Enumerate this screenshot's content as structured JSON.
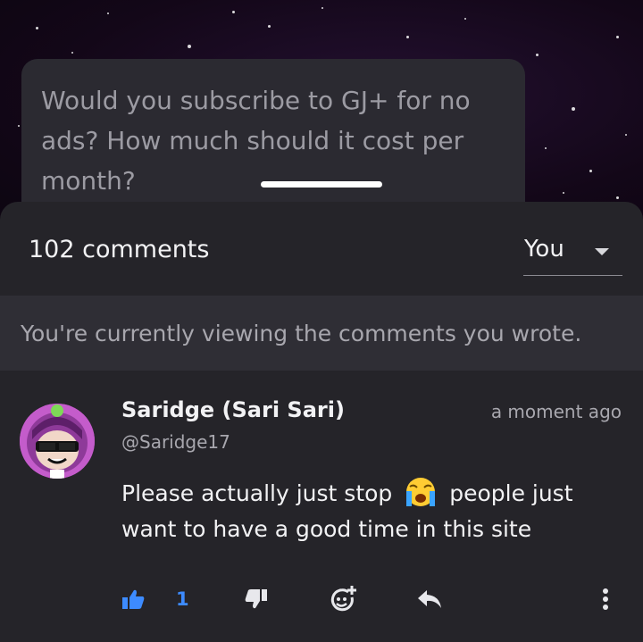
{
  "post": {
    "text": "Would you subscribe to GJ+ for no ads? How much should it cost per month?"
  },
  "comments_panel": {
    "count_label": "102 comments",
    "filter": {
      "selected": "You"
    },
    "notice": "You're currently viewing the comments you wrote."
  },
  "comment": {
    "author_name": "Saridge (Sari Sari)",
    "author_handle": "@Saridge17",
    "timestamp": "a moment ago",
    "body_part1": "Please actually just stop",
    "body_part2": "people just want to have a good time in this site",
    "emoji": "loudly-crying-face",
    "like_count": "1"
  },
  "icons": {
    "like": "thumbs-up-icon",
    "dislike": "thumbs-down-icon",
    "react": "add-emoji-icon",
    "reply": "reply-icon",
    "more": "more-vertical-icon"
  },
  "colors": {
    "accent_blue": "#3d8bff",
    "sheet_bg": "#252429",
    "notice_bg": "#2f2e35",
    "avatar_ring": "#c45ccb"
  }
}
